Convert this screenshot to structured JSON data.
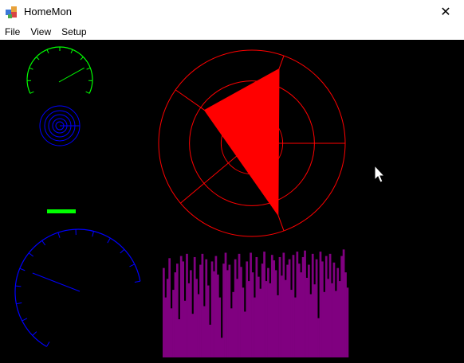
{
  "window": {
    "title": "HomeMon",
    "close_icon": "close-icon",
    "app_icon": "app-icon"
  },
  "menu": {
    "items": [
      "File",
      "View",
      "Setup"
    ]
  },
  "colors": {
    "background": "#000000",
    "gauge_small": "#00ff00",
    "spiral": "#0000ff",
    "status_bar": "#00ff00",
    "gauge_large": "#0000ff",
    "radar": "#ff0000",
    "histogram": "#800080"
  },
  "widgets": {
    "gauge_small": {
      "needle_fraction": 0.78
    },
    "gauge_large": {
      "needle_fraction": 0.36
    },
    "radar": {
      "polygon_fractions": [
        0.62,
        0.85,
        0.82
      ]
    },
    "histogram": {
      "values": [
        0.82,
        0.55,
        0.72,
        0.91,
        0.45,
        0.62,
        0.78,
        0.86,
        0.35,
        0.93,
        0.88,
        0.52,
        0.95,
        0.68,
        0.8,
        0.4,
        0.92,
        0.72,
        0.58,
        0.85,
        0.95,
        0.47,
        0.9,
        0.66,
        0.3,
        0.88,
        0.79,
        0.93,
        0.76,
        0.55,
        0.18,
        0.86,
        0.96,
        0.8,
        0.85,
        0.45,
        0.6,
        0.9,
        0.72,
        0.95,
        0.83,
        0.64,
        0.42,
        0.88,
        0.7,
        0.96,
        0.78,
        0.55,
        0.92,
        0.74,
        0.63,
        0.86,
        0.97,
        0.7,
        0.82,
        0.68,
        0.94,
        0.89,
        0.8,
        0.57,
        0.92,
        0.75,
        0.96,
        0.71,
        0.85,
        0.9,
        0.62,
        0.94,
        0.55,
        0.97,
        0.86,
        0.78,
        0.92,
        0.98,
        0.73,
        0.85,
        0.58,
        0.95,
        0.67,
        0.9,
        0.36,
        0.97,
        0.88,
        0.6,
        0.93,
        0.72,
        0.95,
        0.68,
        0.87,
        0.61,
        0.82,
        0.7,
        0.93,
        0.99,
        0.78,
        0.64
      ]
    }
  }
}
